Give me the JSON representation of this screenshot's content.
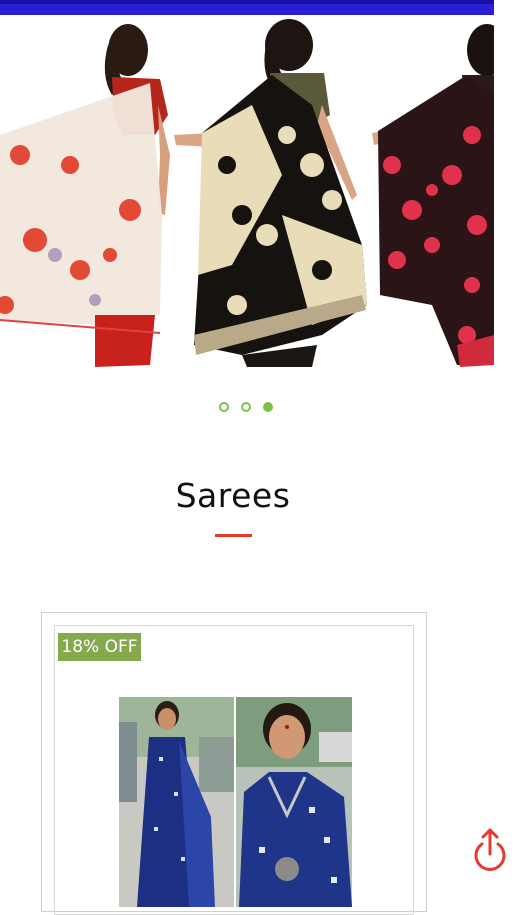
{
  "carousel": {
    "slides": [
      {
        "icon": "saree-image-white-floral"
      },
      {
        "icon": "saree-image-black-beige"
      },
      {
        "icon": "saree-image-red-black-floral"
      }
    ],
    "dots": [
      {
        "active": false
      },
      {
        "active": false
      },
      {
        "active": true
      }
    ],
    "accent_color": "#7cc04a"
  },
  "section": {
    "title": "Sarees",
    "underline_color": "#e23c2f"
  },
  "product_card": {
    "discount_badge": "18% OFF",
    "badge_color": "#86a94e",
    "image_icon": "saree-product-image"
  },
  "share": {
    "icon": "share-icon",
    "color": "#e23c2f"
  },
  "colors": {
    "top_bar": "#2a1fd6"
  }
}
